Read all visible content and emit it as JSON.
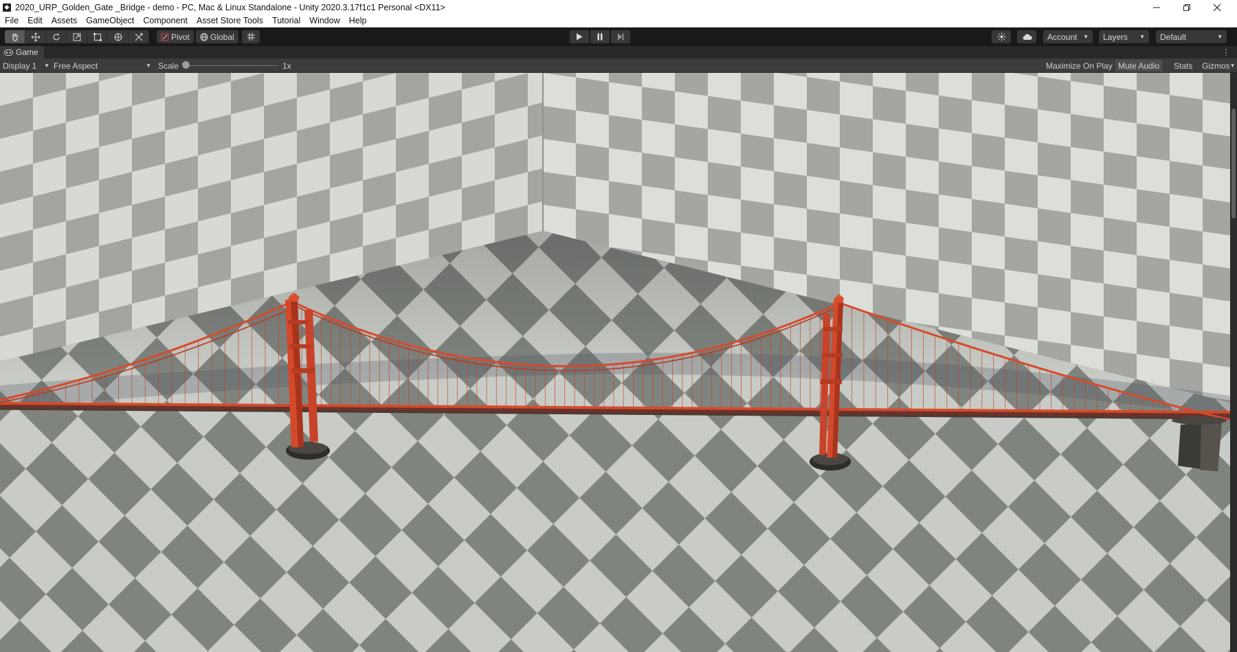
{
  "window": {
    "title": "2020_URP_Golden_Gate _Bridge - demo - PC, Mac & Linux Standalone - Unity 2020.3.17f1c1 Personal <DX11>",
    "minimize_icon": "minimize-icon",
    "restore_icon": "restore-icon",
    "close_icon": "close-icon"
  },
  "menu": [
    "File",
    "Edit",
    "Assets",
    "GameObject",
    "Component",
    "Asset Store Tools",
    "Tutorial",
    "Window",
    "Help"
  ],
  "toolbar": {
    "tools": [
      "hand-tool-icon",
      "move-tool-icon",
      "rotate-tool-icon",
      "scale-tool-icon",
      "rect-tool-icon",
      "transform-tool-icon",
      "custom-tool-icon"
    ],
    "pivot_label": "Pivot",
    "global_label": "Global",
    "grid_snap_icon": "grid-snap-icon",
    "play_icon": "play-icon",
    "pause_icon": "pause-icon",
    "step_icon": "step-icon",
    "services_icon": "services-icon",
    "cloud_icon": "cloud-icon",
    "account_label": "Account",
    "layers_label": "Layers",
    "layout_label": "Default"
  },
  "game_tab": {
    "label": "Game",
    "icon": "gamepad-icon"
  },
  "game_bar": {
    "display": "Display 1",
    "aspect": "Free Aspect",
    "scale_label": "Scale",
    "scale_value": "1x",
    "scale_fraction": 0.0,
    "maximize_on_play": "Maximize On Play",
    "mute_audio": "Mute Audio",
    "stats": "Stats",
    "gizmos": "Gizmos"
  },
  "colors": {
    "bridge": "#d0432a",
    "floor_light": "#c8cbc5",
    "floor_dark": "#7c817c",
    "wall_light": "#d6d9d3",
    "wall_dark": "#9a9e98",
    "editor_dark": "#191919",
    "panel": "#3c3c3c"
  }
}
